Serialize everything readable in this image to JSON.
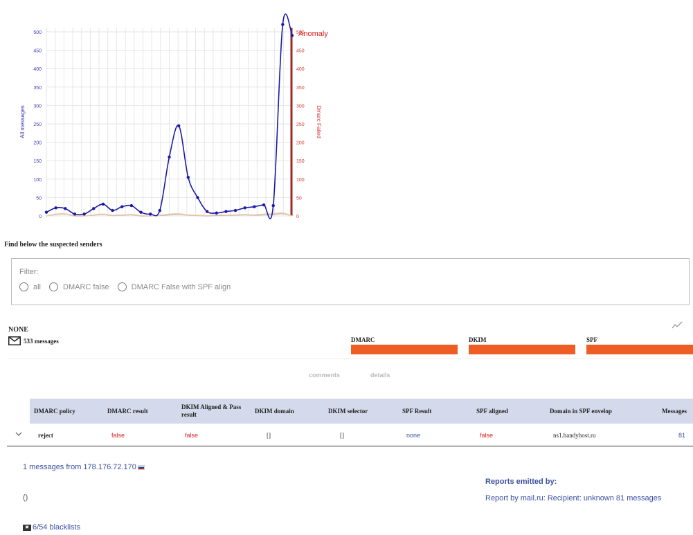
{
  "chart_data": {
    "type": "line",
    "left_axis": {
      "label": "All messages",
      "ticks": [
        0,
        50,
        100,
        150,
        200,
        250,
        300,
        350,
        400,
        450,
        500
      ],
      "range": [
        0,
        500
      ],
      "color": "#3b3bbf"
    },
    "right_axis": {
      "label": "Dmarc Failed",
      "ticks": [
        0,
        50,
        100,
        150,
        200,
        250,
        300,
        350,
        400,
        450,
        500
      ],
      "range": [
        0,
        500
      ],
      "color": "#d33a3a"
    },
    "legend": "Anomaly",
    "grid": true,
    "series": [
      {
        "values": [
          10,
          22,
          20,
          5,
          5,
          20,
          32,
          15,
          25,
          28,
          10,
          5,
          15,
          160,
          245,
          105,
          50,
          12,
          8,
          12,
          15,
          22,
          25,
          30,
          28,
          520,
          490
        ],
        "color": "#1a1aa8"
      },
      {
        "values": [
          0,
          5,
          6,
          1,
          0,
          3,
          5,
          2,
          3,
          4,
          1,
          0,
          2,
          5,
          6,
          3,
          2,
          1,
          3,
          2,
          3,
          4,
          3,
          5,
          6,
          8,
          0
        ],
        "color": "#f3c9a3"
      },
      {
        "values": [
          0,
          4,
          5,
          0,
          0,
          2,
          4,
          1,
          2,
          3,
          0,
          0,
          1,
          3,
          4,
          2,
          1,
          0,
          1,
          1,
          2,
          3,
          2,
          3,
          4,
          6,
          0
        ],
        "color": "#bcbcbc"
      }
    ]
  },
  "intro_text": "Find below the suspected senders",
  "filter": {
    "title": "Filter:",
    "options": [
      "all",
      "DMARC false",
      "DMARC False with SPF align"
    ]
  },
  "sender": {
    "name": "NONE",
    "messages": "533 messages"
  },
  "bars": [
    {
      "label": "DMARC"
    },
    {
      "label": "DKIM"
    },
    {
      "label": "SPF"
    }
  ],
  "tabs": [
    "comments",
    "details"
  ],
  "table": {
    "headers": [
      "DMARC policy",
      "DMARC result",
      "DKIM Aligned & Pass result",
      "DKIM domain",
      "DKIM selector",
      "SPF Result",
      "SPF aligned",
      "Domain in SPF envelop",
      "Messages"
    ],
    "row": [
      "reject",
      "false",
      "false",
      "[]",
      "[]",
      "none",
      "false",
      "ns1.handyhost.ru",
      "81"
    ]
  },
  "ip_line": "1 messages from 178.176.72.170",
  "parens": "()",
  "blacklists": "6/54 blacklists",
  "reports": {
    "title": "Reports emitted by:",
    "item": "Report by mail.ru: Recipient: unknown 81 messages"
  }
}
